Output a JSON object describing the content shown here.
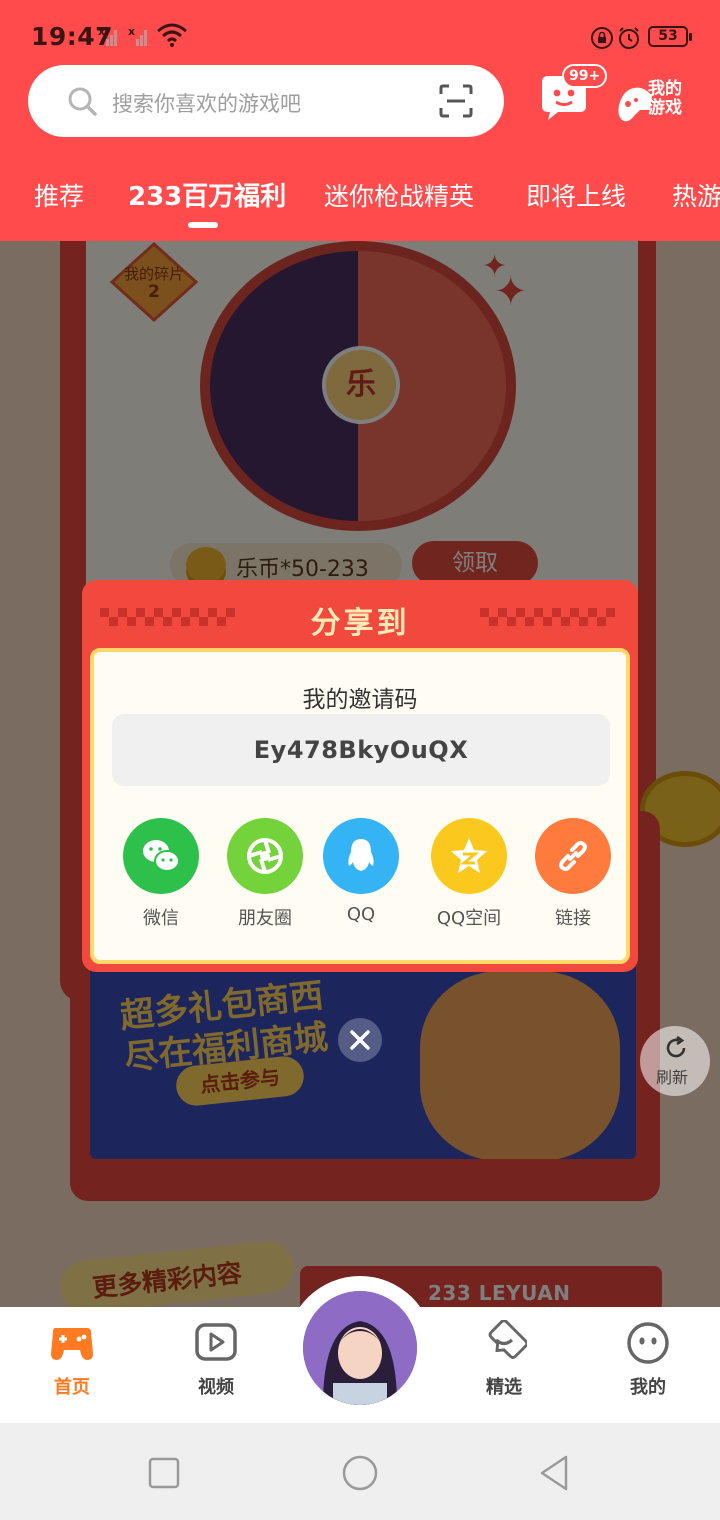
{
  "status_bar": {
    "time": "19:47",
    "battery": "53"
  },
  "search": {
    "placeholder": "搜索你喜欢的游戏吧"
  },
  "header_actions": {
    "messages_badge": "99+",
    "my_games_label": "我的游戏"
  },
  "tabs": [
    {
      "label": "推荐",
      "active": false
    },
    {
      "label": "233百万福利",
      "active": true
    },
    {
      "label": "迷你枪战精英",
      "active": false
    },
    {
      "label": "即将上线",
      "active": false
    },
    {
      "label": "热游",
      "active": false
    }
  ],
  "content": {
    "fragments_label": "我的碎片",
    "fragments_count": "2",
    "wheel_center": "乐",
    "reward": "乐币*50-233",
    "claim_label": "领取",
    "banner_line1": "超多礼包商西",
    "banner_line2": "尽在福利商城",
    "banner_button": "点击参与",
    "more_title": "更多精彩内容",
    "more_strip": "233 LEYUAN",
    "refresh_label": "刷新"
  },
  "share_dialog": {
    "title": "分享到",
    "invite_title": "我的邀请码",
    "invite_code": "Ey478BkyOuQX",
    "targets": [
      {
        "label": "微信",
        "icon": "wechat-icon",
        "color": "#2dc14c"
      },
      {
        "label": "朋友圈",
        "icon": "moments-icon",
        "color": "#74d23a"
      },
      {
        "label": "QQ",
        "icon": "qq-icon",
        "color": "#34b4f4"
      },
      {
        "label": "QQ空间",
        "icon": "qzone-icon",
        "color": "#fbc91e"
      },
      {
        "label": "链接",
        "icon": "link-icon",
        "color": "#ff7a3c"
      }
    ]
  },
  "bottom_nav": [
    {
      "label": "首页",
      "icon": "gamepad-icon",
      "active": true
    },
    {
      "label": "视频",
      "icon": "video-icon",
      "active": false
    },
    {
      "label": "精选",
      "icon": "heart-chat-icon",
      "active": false
    },
    {
      "label": "我的",
      "icon": "face-icon",
      "active": false
    }
  ],
  "colors": {
    "brand_red": "#ff4b4b",
    "active_orange": "#ff7a20"
  }
}
